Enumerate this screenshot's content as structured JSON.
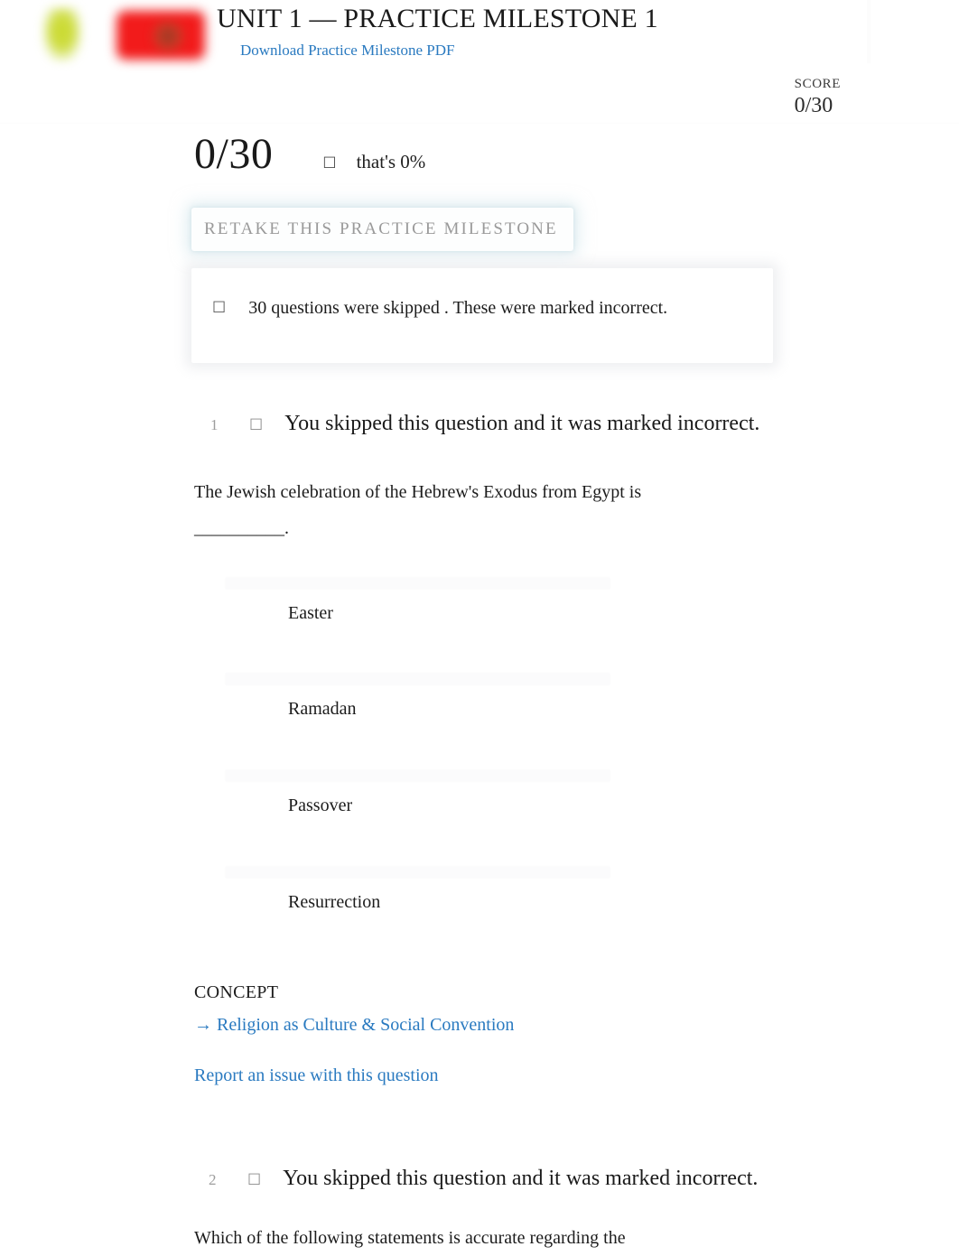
{
  "header": {
    "unit_title": "UNIT 1 — PRACTICE MILESTONE 1",
    "pdf_link": "Download Practice Milestone PDF",
    "score_label": "SCORE",
    "score_value": "0/30",
    "logo_leaf_color": "#cada2c",
    "logo_tile_color": "#f21b1b"
  },
  "summary": {
    "big_score": "0/30",
    "percent_icon": "☐",
    "percent_text": "that's 0%",
    "retake_button": "RETAKE THIS PRACTICE MILESTONE",
    "notice_icon": "☐",
    "notice_text": "30  questions were    skipped  . These were marked incorrect."
  },
  "questions": [
    {
      "number": "1",
      "skip_icon": "☐",
      "status": "You skipped this question and it was marked incorrect.",
      "prompt": "The Jewish celebration of the Hebrew's Exodus from Egypt is __________.",
      "options": [
        {
          "label": "Easter"
        },
        {
          "label": "Ramadan"
        },
        {
          "label": "Passover"
        },
        {
          "label": "Resurrection"
        }
      ],
      "concept_title": "CONCEPT",
      "concept_link": "→ Religion as Culture & Social Convention",
      "report_link": "Report an issue with this question"
    },
    {
      "number": "2",
      "skip_icon": "☐",
      "status": "You skipped this question and it was marked incorrect.",
      "prompt": "Which of the following statements is accurate regarding the"
    }
  ],
  "colors": {
    "link": "#2a7ac0",
    "text": "#1c1c1c",
    "muted": "#9d9d9d",
    "retake_glow": "#c4dee6",
    "option_bar": "#fbfbfc"
  }
}
